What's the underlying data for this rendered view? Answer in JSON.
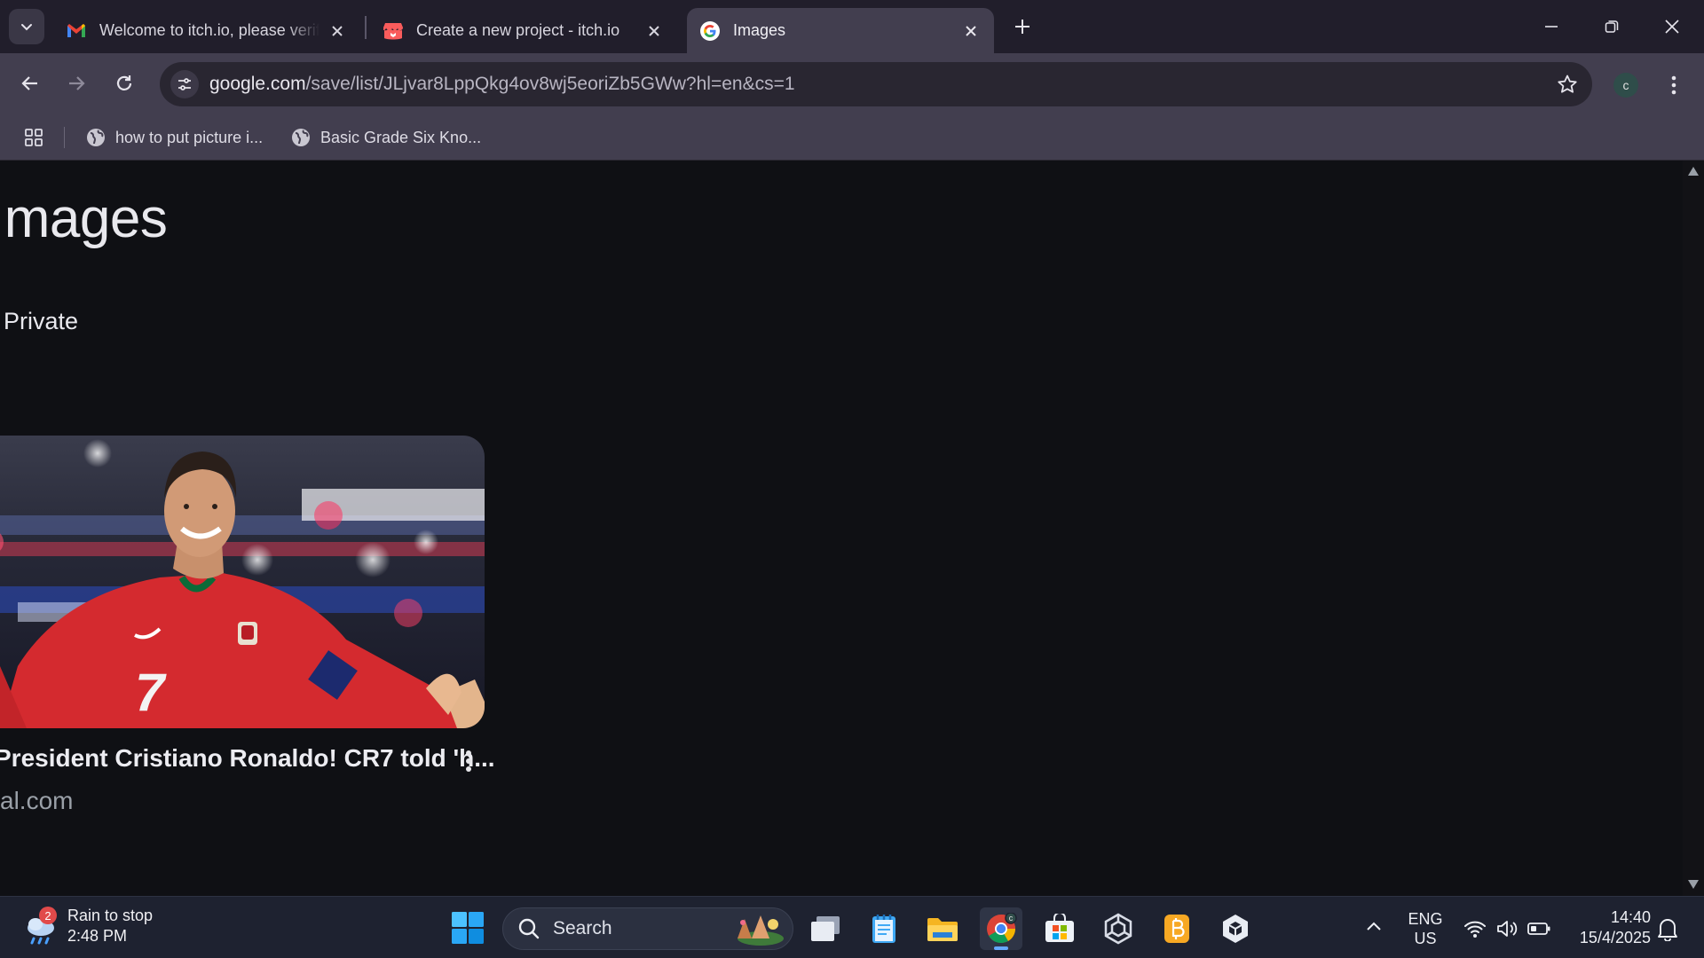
{
  "tabs": [
    {
      "title": "Welcome to itch.io, please verify your account",
      "favicon": "gmail-icon"
    },
    {
      "title": "Create a new project - itch.io",
      "favicon": "itchio-icon"
    },
    {
      "title": "Images",
      "favicon": "google-icon"
    }
  ],
  "toolbar": {
    "url_host": "google.com",
    "url_path": "/save/list/JLjvar8LppQkg4ov8wj5eoriZb5GWw?hl=en&cs=1",
    "profile_initial": "c"
  },
  "bookmarks": [
    {
      "label": "how to put picture i..."
    },
    {
      "label": "Basic Grade Six Kno..."
    }
  ],
  "page": {
    "title": "Images",
    "privacy": "Private",
    "card": {
      "title": "President Cristiano Ronaldo! CR7 told 'h...",
      "source": "al.com",
      "jersey_number": "7"
    }
  },
  "taskbar": {
    "weather_badge": "2",
    "weather_line1": "Rain to stop",
    "weather_line2": "2:48 PM",
    "search_label": "Search",
    "lang_line1": "ENG",
    "lang_line2": "US",
    "time": "14:40",
    "date": "15/4/2025",
    "chrome_badge": "c"
  },
  "colors": {
    "tabstrip": "#211e2b",
    "toolbar": "#423e4f",
    "page_bg": "#0f1014",
    "taskbar": "#1e2230",
    "accent": "#64a9ff"
  }
}
